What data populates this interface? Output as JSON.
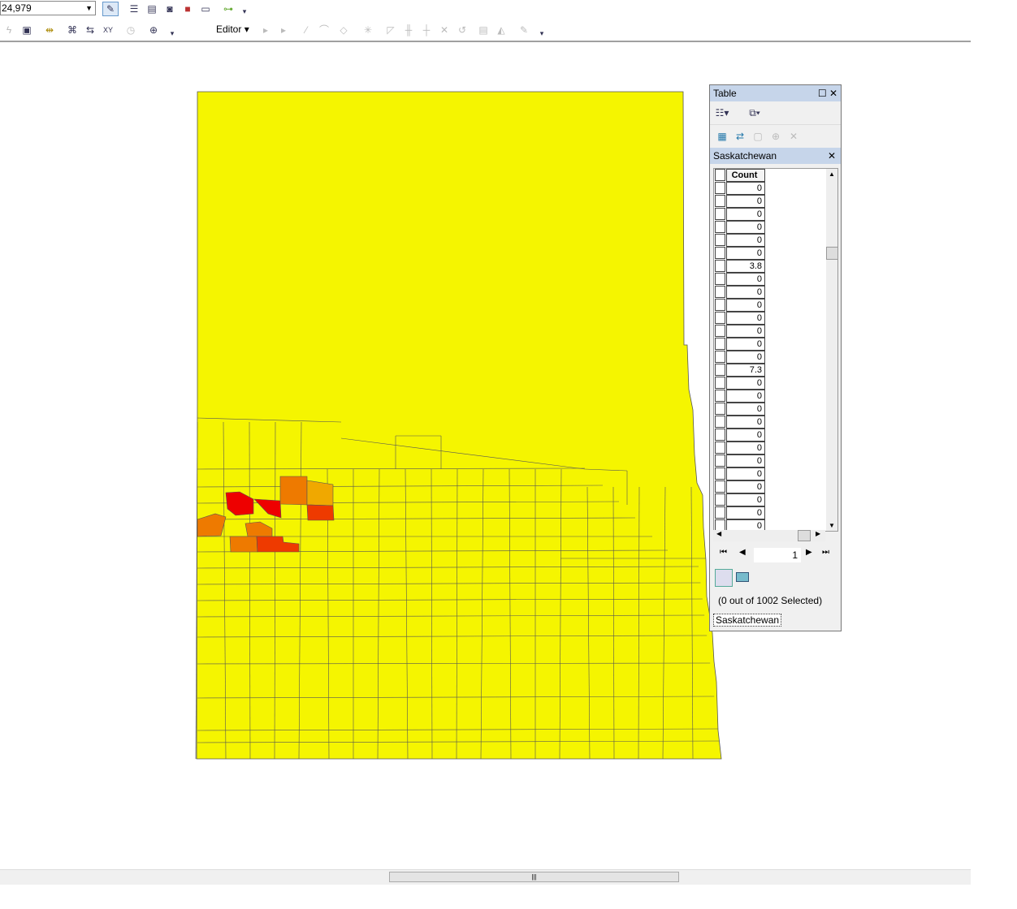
{
  "toolbar": {
    "scale_value": "24,979",
    "editor_label": "Editor"
  },
  "table_window": {
    "title": "Table",
    "layer_tab": "Saskatchewan",
    "column_header": "Count",
    "rows": [
      "0",
      "0",
      "0",
      "0",
      "0",
      "0",
      "3.8",
      "0",
      "0",
      "0",
      "0",
      "0",
      "0",
      "0",
      "7.3",
      "0",
      "0",
      "0",
      "0",
      "0",
      "0",
      "0",
      "0",
      "0",
      "0",
      "0",
      "0"
    ],
    "current_record": "1",
    "selection_status": "(0 out of 1002 Selected)",
    "source_tab": "Saskatchewan"
  },
  "map": {
    "fill_color": "#f5f500",
    "highlight_colors": [
      "#ee0000",
      "#ee3a00",
      "#ee7a00",
      "#f0a800"
    ]
  }
}
